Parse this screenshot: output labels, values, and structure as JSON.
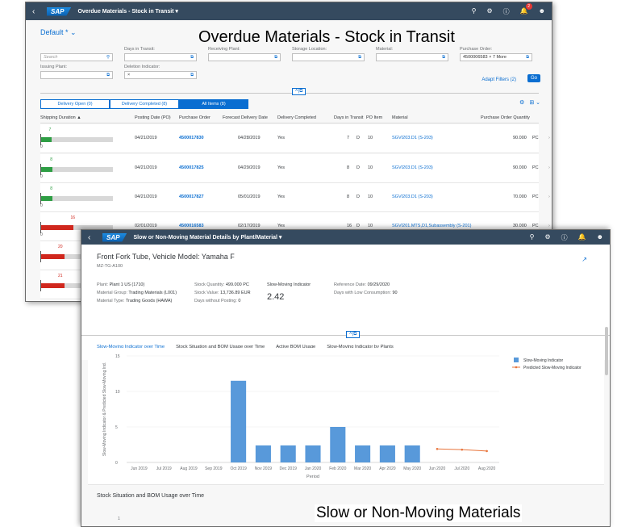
{
  "overdue": {
    "app_title": "Overdue Materials - Stock in Transit ▾",
    "notif_count": "2",
    "variant": "Default *",
    "caption": "Overdue Materials - Stock in Transit",
    "filters": {
      "search_placeholder": "Search",
      "days_in_transit_label": "Days in Transit:",
      "receiving_plant_label": "Receiving Plant:",
      "storage_location_label": "Storage Location:",
      "material_label": "Material:",
      "purchase_order_label": "Purchase Order:",
      "purchase_order_value": "4500006583 ×  7 More",
      "issuing_plant_label": "Issuing Plant:",
      "deletion_indicator_label": "Deletion Indicator:",
      "deletion_indicator_value": "×",
      "adapt_filters": "Adapt Filters (2)",
      "go": "Go"
    },
    "tabs": [
      "Delivery Open (0)",
      "Delivery Completed (8)",
      "All Items (8)"
    ],
    "columns": [
      "Shipping Duration ▲",
      "Posting Date (PO)",
      "Purchase Order",
      "Forecast Delivery Date",
      "Delivery Completed",
      "Days in Transit",
      "PO Item",
      "Material",
      "Purchase Order Quantity"
    ],
    "rows": [
      {
        "dur": "7",
        "posting": "04/21/2019",
        "po": "4500017830",
        "forecast": "04/28/2019",
        "completed": "Yes",
        "days": "7",
        "unit_d": "D",
        "item": "10",
        "material": "SGVI203.D1 (S-203)",
        "qty": "90.000",
        "uom": "PC",
        "color": "#2e9e44",
        "fill": 0.15
      },
      {
        "dur": "8",
        "posting": "04/21/2019",
        "po": "4500017825",
        "forecast": "04/29/2019",
        "completed": "Yes",
        "days": "8",
        "unit_d": "D",
        "item": "10",
        "material": "SGVI203.D1 (S-203)",
        "qty": "90.000",
        "uom": "PC",
        "color": "#2e9e44",
        "fill": 0.17
      },
      {
        "dur": "8",
        "posting": "04/21/2019",
        "po": "4500017827",
        "forecast": "05/01/2019",
        "completed": "Yes",
        "days": "8",
        "unit_d": "D",
        "item": "10",
        "material": "SGVI203.D1 (S-203)",
        "qty": "70.000",
        "uom": "PC",
        "color": "#2e9e44",
        "fill": 0.17
      },
      {
        "dur": "16",
        "posting": "02/01/2019",
        "po": "4500016583",
        "forecast": "02/17/2019",
        "completed": "Yes",
        "days": "16",
        "unit_d": "D",
        "item": "10",
        "material": "SGVI201.MTS,D1,Subassembly (S-201)",
        "qty": "30.000",
        "uom": "PC",
        "color": "#d0271d",
        "fill": 0.45
      }
    ],
    "extra_durations": [
      "20",
      "21",
      "21"
    ]
  },
  "slow": {
    "app_title": "Slow or Non-Moving Material Details by Plant/Material ▾",
    "object_title": "Front Fork Tube, Vehicle Model: Yamaha F",
    "object_sub": "MZ-TG-A100",
    "plant_label": "Plant:",
    "plant_value": "Plant 1 US (1710)",
    "group_label": "Material Group:",
    "group_value": "Trading Materials (L001)",
    "type_label": "Material Type:",
    "type_value": "Trading Goods (HAWA)",
    "stock_qty_label": "Stock Quantity:",
    "stock_qty_value": "499.000 PC",
    "stock_val_label": "Stock Value:",
    "stock_val_value": "13,736.89 EUR",
    "days_wo_label": "Days without Posting:",
    "days_wo_value": "0",
    "smi_label": "Slow-Moving Indicator",
    "smi_value": "2.42",
    "ref_date_label": "Reference Date:",
    "ref_date_value": "09/29/2020",
    "low_cons_label": "Days with Low Consumption:",
    "low_cons_value": "90",
    "tabs": [
      "Slow-Moving Indicator over Time",
      "Stock Situation and BOM Usage over Time",
      "Active BOM Usage",
      "Slow-Moving Indicator by Plants"
    ],
    "section2_title": "Stock Situation and BOM Usage over Time",
    "section2_tick": "1",
    "caption": "Slow or Non-Moving Materials"
  },
  "chart_data": {
    "type": "bar",
    "xlabel": "Period",
    "ylabel": "Slow-Moving Indicator & Predicted Slow-Moving Ind.",
    "ylim": [
      0,
      15
    ],
    "yticks": [
      0,
      5,
      10,
      15
    ],
    "categories": [
      "Jun 2019",
      "Jul 2019",
      "Aug 2019",
      "Sep 2019",
      "Oct 2019",
      "Nov 2019",
      "Dec 2019",
      "Jan 2020",
      "Feb 2020",
      "Mar 2020",
      "Apr 2020",
      "May 2020",
      "Jun 2020",
      "Jul 2020",
      "Aug 2020"
    ],
    "series": [
      {
        "name": "Slow-Moving Indicator",
        "kind": "bar",
        "color": "#5899da",
        "values": [
          null,
          null,
          null,
          null,
          11.5,
          2.4,
          2.4,
          2.4,
          5.0,
          2.4,
          2.4,
          2.4,
          null,
          null,
          null
        ]
      },
      {
        "name": "Predicted Slow-Moving Indicator",
        "kind": "line",
        "color": "#e8743b",
        "values": [
          null,
          null,
          null,
          null,
          null,
          null,
          null,
          null,
          null,
          null,
          null,
          null,
          1.9,
          1.8,
          1.6
        ]
      }
    ],
    "legend": "top-right"
  }
}
